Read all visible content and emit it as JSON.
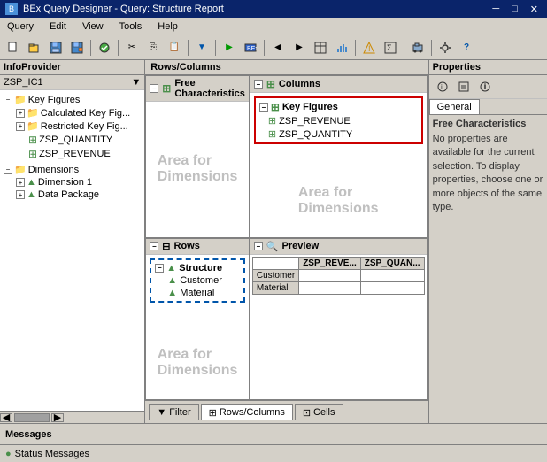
{
  "window": {
    "title": "BEx Query Designer - Query: Structure Report",
    "icon": "bex-icon"
  },
  "menu": {
    "items": [
      "Query",
      "Edit",
      "View",
      "Tools",
      "Help"
    ]
  },
  "toolbar": {
    "buttons": [
      "new",
      "open",
      "save",
      "save-as",
      "sep",
      "check",
      "sep",
      "cut",
      "copy",
      "paste",
      "sep",
      "filter",
      "sep",
      "run",
      "sep",
      "col-prev",
      "col-next",
      "sep",
      "exception",
      "condition",
      "sep",
      "transport",
      "sep",
      "settings"
    ]
  },
  "infoprovider": {
    "title": "InfoProvider",
    "provider": "ZSP_IC1",
    "tree": [
      {
        "id": "key-figures",
        "label": "Key Figures",
        "type": "folder",
        "expanded": true,
        "children": [
          {
            "id": "calc-key",
            "label": "Calculated Key Fig...",
            "type": "folder",
            "expanded": false
          },
          {
            "id": "restricted-key",
            "label": "Restricted Key Fig...",
            "type": "folder",
            "expanded": false
          },
          {
            "id": "zsp-quantity",
            "label": "ZSP_QUANTITY",
            "type": "key"
          },
          {
            "id": "zsp-revenue",
            "label": "ZSP_REVENUE",
            "type": "key"
          }
        ]
      },
      {
        "id": "dimensions",
        "label": "Dimensions",
        "type": "folder",
        "expanded": true,
        "children": [
          {
            "id": "dim1",
            "label": "Dimension 1",
            "type": "dim",
            "expanded": false
          },
          {
            "id": "data-pkg",
            "label": "Data Package",
            "type": "dim",
            "expanded": false
          }
        ]
      }
    ]
  },
  "center": {
    "title": "Rows/Columns",
    "free_chars": {
      "title": "Free Characteristics",
      "area_label": "Area for\nDimensions"
    },
    "columns": {
      "title": "Columns",
      "key_figures_node": "Key Figures",
      "items": [
        "ZSP_REVENUE",
        "ZSP_QUANTITY"
      ],
      "area_label": "Area for\nDimensions"
    },
    "rows": {
      "title": "Rows",
      "structure_label": "Structure",
      "items": [
        "Customer",
        "Material"
      ],
      "area_label": "Area for\nDimensions"
    },
    "preview": {
      "title": "Preview",
      "col_headers": [
        "ZSP_REVE...",
        "ZSP_QUAN..."
      ],
      "row_headers": [
        "Customer",
        "Material"
      ]
    }
  },
  "properties": {
    "title": "Properties",
    "subtitle": "Free Characteristics",
    "tabs": [
      "General"
    ],
    "description": "No properties are available for the current selection. To display properties, choose one or more objects of the same type."
  },
  "bottom_tabs": [
    {
      "label": "Filter",
      "active": false
    },
    {
      "label": "Rows/Columns",
      "active": true
    },
    {
      "label": "Cells",
      "active": false
    }
  ],
  "messages": {
    "title": "Messages",
    "status": "Status Messages"
  },
  "icons": {
    "folder": "📁",
    "key": "🔑",
    "dimension": "▲",
    "structure": "▲",
    "expand_plus": "+",
    "expand_minus": "−",
    "filter": "▼",
    "rows_cols": "⊞",
    "cells": "⊡"
  }
}
